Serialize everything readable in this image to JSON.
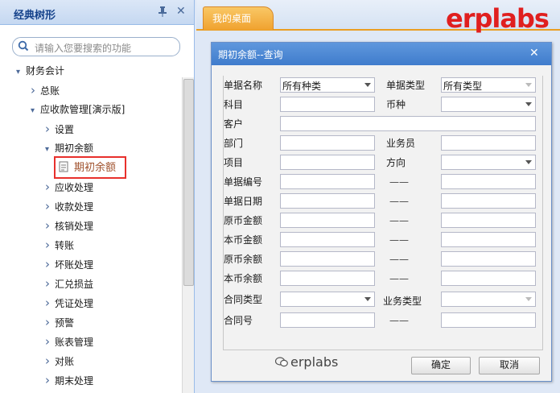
{
  "left_panel": {
    "title": "经典树形",
    "search_placeholder": "请输入您要搜索的功能",
    "tree": [
      {
        "label": "财务会计",
        "arrow": "▾",
        "level": 0
      },
      {
        "label": "总账",
        "arrow": "›",
        "level": 1
      },
      {
        "label": "应收款管理[演示版]",
        "arrow": "▾",
        "level": 1
      },
      {
        "label": "设置",
        "arrow": "›",
        "level": 2
      },
      {
        "label": "期初余额",
        "arrow": "▾",
        "level": 2
      },
      {
        "label": "期初余额",
        "arrow": "",
        "level": 3,
        "selected": true
      },
      {
        "label": "应收处理",
        "arrow": "›",
        "level": 2
      },
      {
        "label": "收款处理",
        "arrow": "›",
        "level": 2
      },
      {
        "label": "核销处理",
        "arrow": "›",
        "level": 2
      },
      {
        "label": "转账",
        "arrow": "›",
        "level": 2
      },
      {
        "label": "坏账处理",
        "arrow": "›",
        "level": 2
      },
      {
        "label": "汇兑损益",
        "arrow": "›",
        "level": 2
      },
      {
        "label": "凭证处理",
        "arrow": "›",
        "level": 2
      },
      {
        "label": "预警",
        "arrow": "›",
        "level": 2
      },
      {
        "label": "账表管理",
        "arrow": "›",
        "level": 2
      },
      {
        "label": "对账",
        "arrow": "›",
        "level": 2
      },
      {
        "label": "期末处理",
        "arrow": "›",
        "level": 2
      }
    ]
  },
  "tabs": {
    "desktop": "我的桌面"
  },
  "brand": "erplabs",
  "dialog": {
    "title": "期初余额--查询",
    "labels": {
      "doc_name": "单据名称",
      "doc_type": "单据类型",
      "subject": "科目",
      "currency": "币种",
      "customer": "客户",
      "department": "部门",
      "salesperson": "业务员",
      "project": "项目",
      "direction": "方向",
      "doc_no": "单据编号",
      "doc_date": "单据日期",
      "orig_amount": "原币金额",
      "local_amount": "本币金额",
      "orig_balance": "原币余额",
      "local_balance": "本币余额",
      "contract_type": "合同类型",
      "business_type": "业务类型",
      "contract_no": "合同号",
      "dash": "——"
    },
    "values": {
      "doc_name": "所有种类",
      "doc_type": "所有类型"
    },
    "buttons": {
      "ok": "确定",
      "cancel": "取消"
    }
  },
  "watermark": "erplabs"
}
